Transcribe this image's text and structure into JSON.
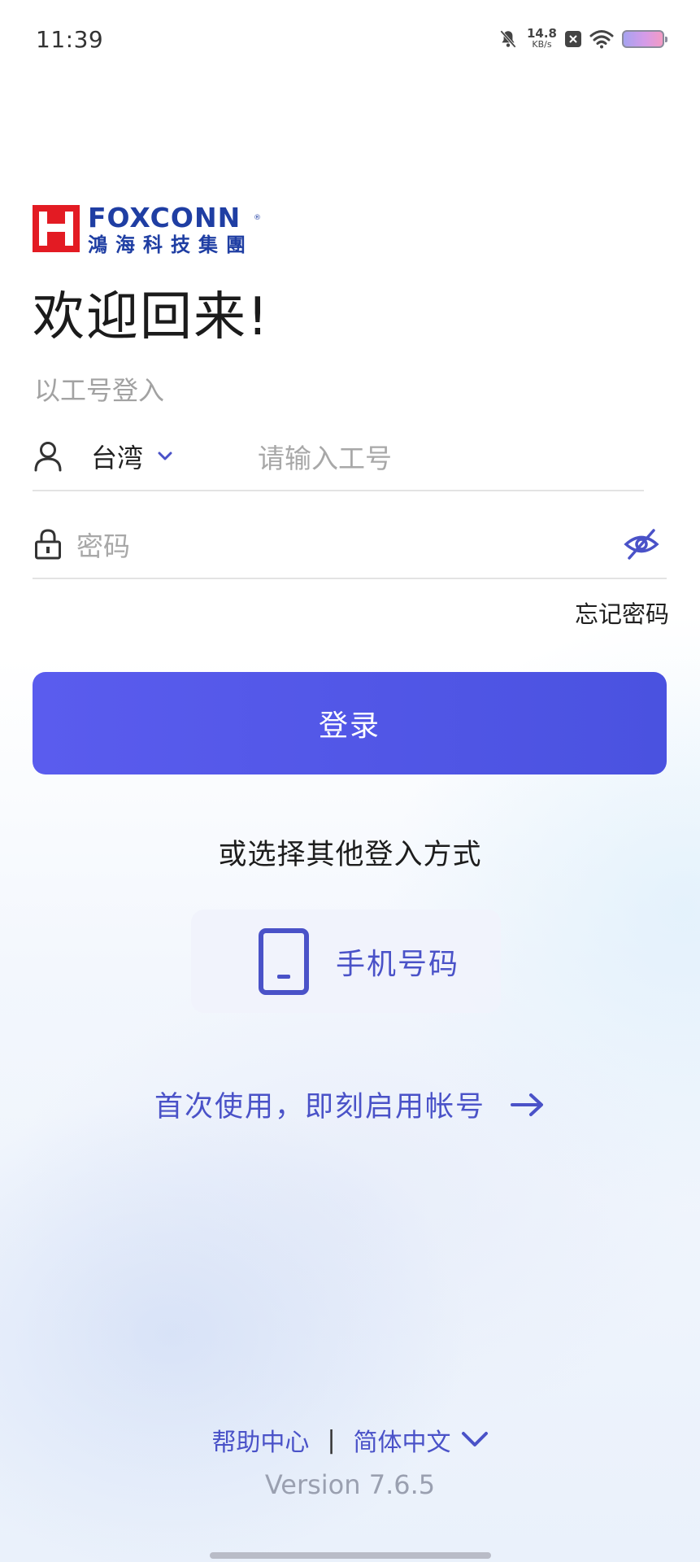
{
  "status_bar": {
    "time": "11:39",
    "net_speed_value": "14.8",
    "net_speed_unit": "KB/s",
    "icons": [
      "bell-off-icon",
      "close-box-icon",
      "wifi-icon",
      "battery-icon"
    ]
  },
  "logo": {
    "brand_en": "FOXCONN",
    "brand_zh": "鴻海科技集團",
    "brand_color": "#1f3ea3",
    "mark_color": "#e31b23"
  },
  "welcome": "欢迎回来!",
  "subtitle": "以工号登入",
  "account": {
    "region": "台湾",
    "id_placeholder": "请输入工号"
  },
  "password": {
    "placeholder": "密码"
  },
  "forgot_password": "忘记密码",
  "login_button": "登录",
  "other_methods": {
    "title": "或选择其他登入方式",
    "phone_label": "手机号码"
  },
  "first_use": "首次使用，即刻启用帐号",
  "footer": {
    "help": "帮助中心",
    "separator": "|",
    "language": "简体中文",
    "version": "Version 7.6.5"
  },
  "colors": {
    "accent": "#4a52e0",
    "link": "#4a52c8"
  }
}
